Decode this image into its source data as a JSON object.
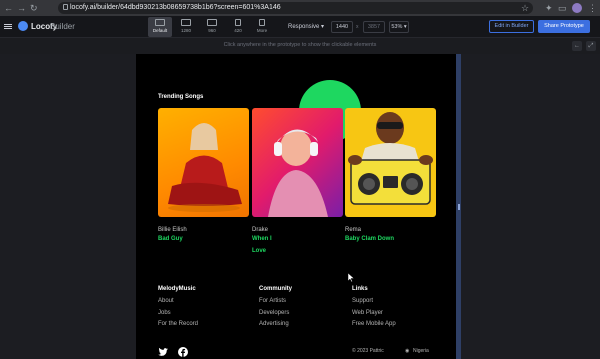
{
  "browser": {
    "url": "locofy.ai/builder/64dbd930213b08659738b1b6?screen=601%3A146"
  },
  "toolbar": {
    "brand": "Locofy",
    "brand_sub": "Builder",
    "devices": [
      {
        "label": "Default"
      },
      {
        "label": "1280"
      },
      {
        "label": "960"
      },
      {
        "label": "420"
      },
      {
        "label": "More"
      }
    ],
    "responsive_label": "Responsive",
    "width_value": "1440",
    "height_value": "3857",
    "zoom_value": "53%",
    "edit_label": "Edit in Builder",
    "share_label": "Share Prototype"
  },
  "infobar": {
    "message": "Click anywhere in the prototype to show the clickable elements"
  },
  "trending": {
    "title": "Trending Songs",
    "songs": [
      {
        "artist": "Billie Eilish",
        "title": "Bad Guy"
      },
      {
        "artist": "Drake",
        "title_line1": "When I",
        "title_line2": "Love"
      },
      {
        "artist": "Rema",
        "title": "Baby Clam Down"
      }
    ]
  },
  "footer": {
    "brand": "MelodyMusic",
    "brand_links": [
      "About",
      "Jobs",
      "For the Record"
    ],
    "community": "Community",
    "community_links": [
      "For Artists",
      "Developers",
      "Advertising"
    ],
    "links_title": "Links",
    "links": [
      "Support",
      "Web Player",
      "Free Mobile App"
    ],
    "copyright": "© 2023 Pattric",
    "country": "Nigeria"
  },
  "colors": {
    "accent_green": "#1ed760",
    "brand_blue": "#3c6fe0"
  }
}
